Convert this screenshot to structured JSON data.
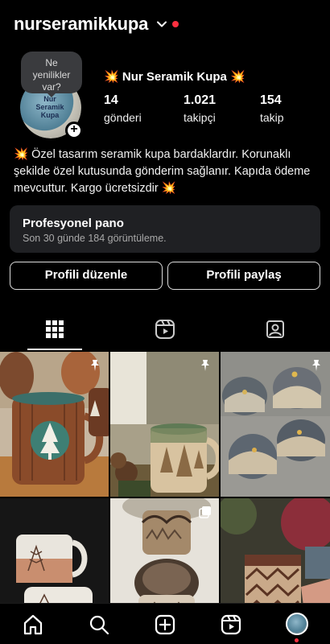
{
  "header": {
    "username": "nurseramikkupa",
    "dropdown_icon": "chevron-down-icon",
    "notification_color": "#ff3040"
  },
  "note_bubble": {
    "line1": "Ne",
    "line2": "yenilikler",
    "line3": "var?"
  },
  "avatar": {
    "text": "Nur Seramik Kupa",
    "add_icon": "plus-icon",
    "add_symbol": "+"
  },
  "profile": {
    "spark_left": "💥",
    "display_name": "Nur Seramik Kupa",
    "spark_right": "💥"
  },
  "stats": [
    {
      "value": "14",
      "label": "gönderi"
    },
    {
      "value": "1.021",
      "label": "takipçi"
    },
    {
      "value": "154",
      "label": "takip"
    }
  ],
  "bio": {
    "spark_start": "💥",
    "text": " Özel tasarım seramik kupa bardaklardır. Korunaklı şekilde özel kutusunda gönderim sağlanır. Kapıda ödeme mevcuttur. Kargo ücretsizdir ",
    "spark_end": "💥"
  },
  "dashboard": {
    "title": "Profesyonel pano",
    "subtitle": "Son 30 günde 184 görüntüleme."
  },
  "buttons": {
    "edit": "Profili düzenle",
    "share": "Profili paylaş"
  },
  "tabs": [
    {
      "icon": "grid-icon",
      "active": true
    },
    {
      "icon": "reels-icon",
      "active": false
    },
    {
      "icon": "tagged-icon",
      "active": false
    }
  ],
  "posts": [
    {
      "subject": "wooden mug with pine tree",
      "pinned": true
    },
    {
      "subject": "ceramic mug with trees and pine cones",
      "pinned": true
    },
    {
      "subject": "four mugs with mountain sunset",
      "pinned": true
    },
    {
      "subject": "white mugs with branch drawing",
      "pinned": false
    },
    {
      "subject": "stacked mugs with mountain pattern",
      "pinned": false,
      "multi": true
    },
    {
      "subject": "patterned mug held in hand",
      "pinned": false
    }
  ],
  "bottom_nav": [
    {
      "icon": "home-icon"
    },
    {
      "icon": "search-icon"
    },
    {
      "icon": "create-icon"
    },
    {
      "icon": "reels-icon"
    },
    {
      "icon": "profile-avatar-icon"
    }
  ],
  "colors": {
    "background": "#000000",
    "card": "#1f2023",
    "accent": "#ff3040"
  }
}
